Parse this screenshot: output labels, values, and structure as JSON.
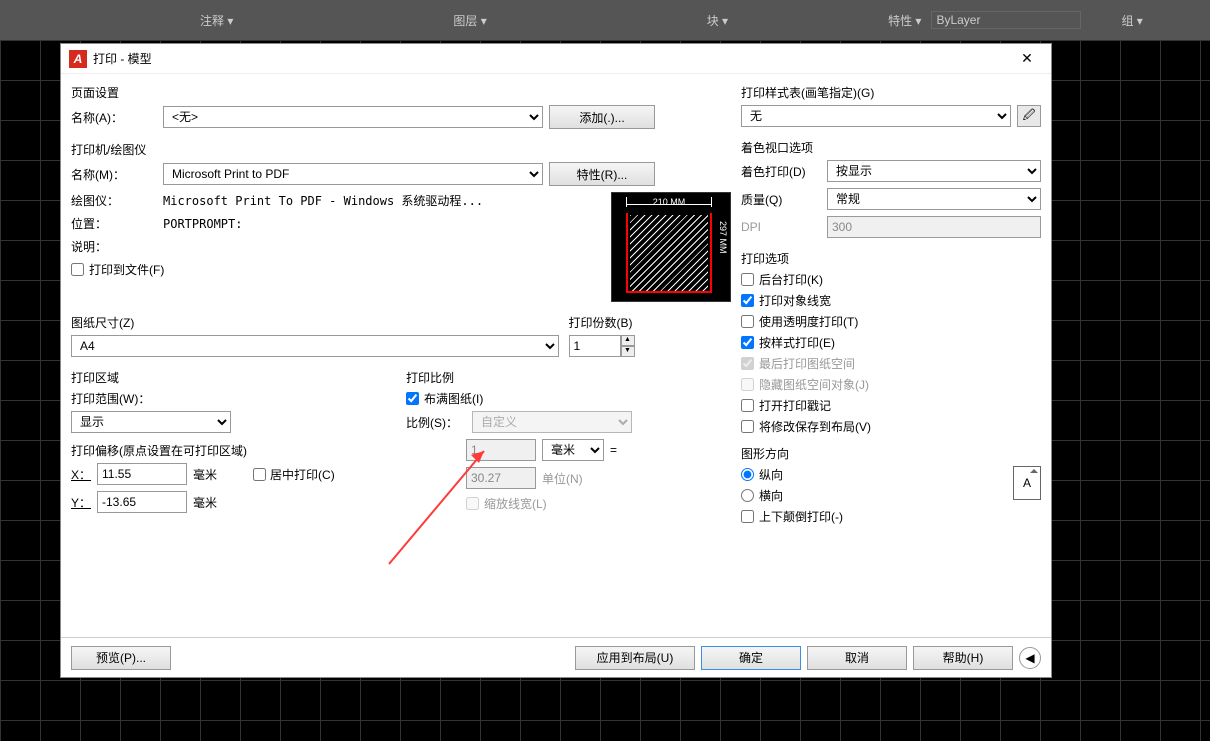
{
  "dialog_title": "打印 - 模型",
  "page_setup": {
    "heading": "页面设置",
    "name_label": "名称(A)：",
    "name_value": "<无>",
    "add_button": "添加(.)..."
  },
  "printer": {
    "heading": "打印机/绘图仪",
    "name_label": "名称(M)：",
    "name_value": "Microsoft Print to PDF",
    "props_button": "特性(R)...",
    "plotter_label": "绘图仪：",
    "plotter_value": "Microsoft Print To PDF - Windows 系统驱动程...",
    "location_label": "位置：",
    "location_value": "PORTPROMPT:",
    "desc_label": "说明：",
    "desc_value": "",
    "print_to_file": "打印到文件(F)",
    "preview_dim_w": "210 MM",
    "preview_dim_h": "297 MM"
  },
  "paper_size": {
    "heading": "图纸尺寸(Z)",
    "value": "A4"
  },
  "copies": {
    "heading": "打印份数(B)",
    "value": "1"
  },
  "print_area": {
    "heading": "打印区域",
    "range_label": "打印范围(W)：",
    "range_value": "显示"
  },
  "print_scale": {
    "heading": "打印比例",
    "fit_label": "布满图纸(I)",
    "scale_label": "比例(S)：",
    "scale_value": "自定义",
    "unit1_value": "1",
    "unit1_label": "毫米",
    "eq": "=",
    "unit2_value": "30.27",
    "unit2_label": "单位(N)",
    "scale_lw": "缩放线宽(L)"
  },
  "offset": {
    "heading": "打印偏移(原点设置在可打印区域)",
    "x_label": "X：",
    "x_value": "11.55",
    "y_label": "Y：",
    "y_value": "-13.65",
    "mm": "毫米",
    "center": "居中打印(C)"
  },
  "style_table": {
    "heading": "打印样式表(画笔指定)(G)",
    "value": "无"
  },
  "shade_viewport": {
    "heading": "着色视口选项",
    "shade_label": "着色打印(D)",
    "shade_value": "按显示",
    "quality_label": "质量(Q)",
    "quality_value": "常规",
    "dpi_label": "DPI",
    "dpi_value": "300"
  },
  "print_options": {
    "heading": "打印选项",
    "background": "后台打印(K)",
    "object_lw": "打印对象线宽",
    "transparency": "使用透明度打印(T)",
    "by_style": "按样式打印(E)",
    "last_paperspace": "最后打印图纸空间",
    "hide_paperspace": "隐藏图纸空间对象(J)",
    "stamp": "打开打印戳记",
    "save_layout": "将修改保存到布局(V)"
  },
  "orientation": {
    "heading": "图形方向",
    "portrait": "纵向",
    "landscape": "横向",
    "upside_down": "上下颠倒打印(-)",
    "glyph": "A"
  },
  "footer": {
    "preview": "预览(P)...",
    "apply_layout": "应用到布局(U)",
    "ok": "确定",
    "cancel": "取消",
    "help": "帮助(H)"
  },
  "ribbon_groups": [
    "注释 ▾",
    "图层 ▾",
    "块 ▾",
    "特性 ▾",
    "组 ▾"
  ],
  "ribbon_layer": "ByLayer"
}
